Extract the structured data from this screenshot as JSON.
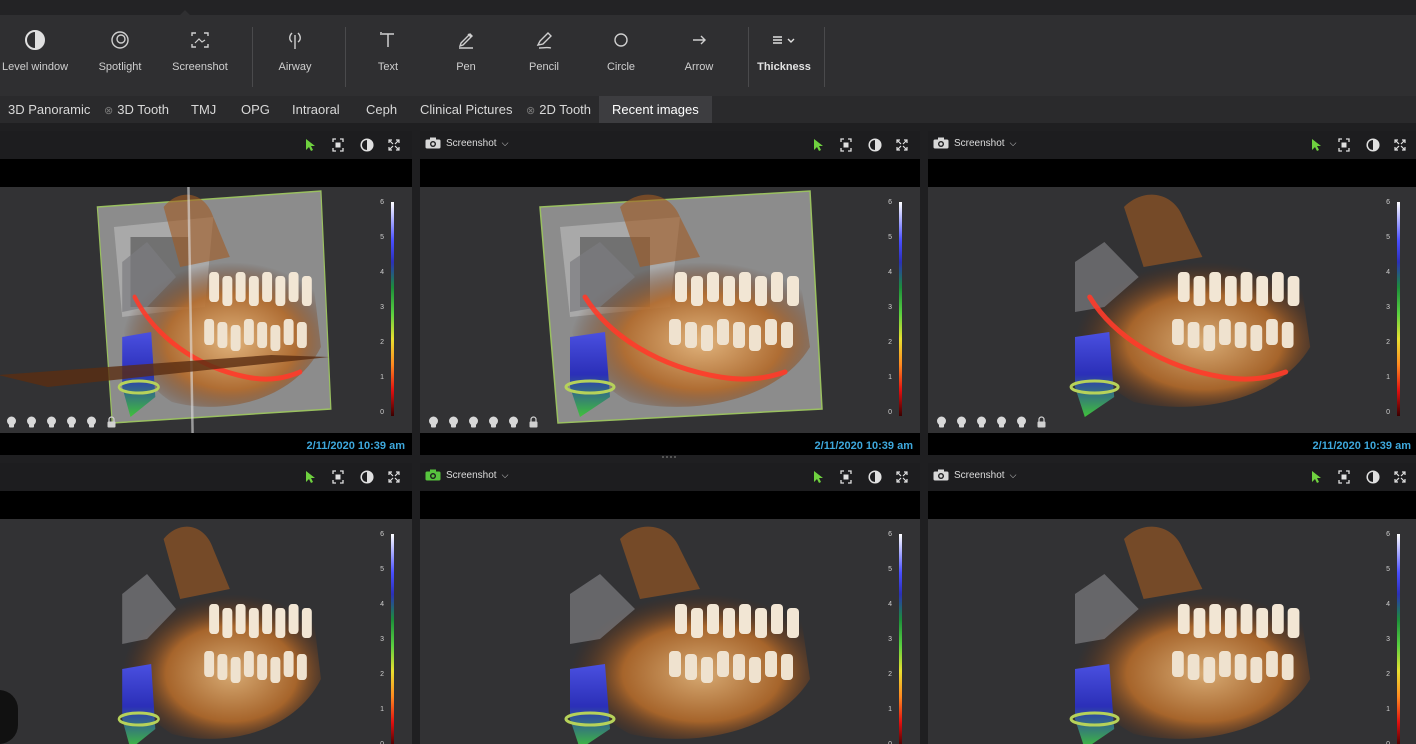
{
  "toolbar": {
    "tools": [
      {
        "label": "Level window",
        "icon": "level-window-icon"
      },
      {
        "label": "Spotlight",
        "icon": "spotlight-icon"
      },
      {
        "label": "Screenshot",
        "icon": "screenshot-icon"
      },
      {
        "label": "Airway",
        "icon": "airway-icon"
      },
      {
        "label": "Text",
        "icon": "text-icon"
      },
      {
        "label": "Pen",
        "icon": "pen-icon"
      },
      {
        "label": "Pencil",
        "icon": "pencil-icon"
      },
      {
        "label": "Circle",
        "icon": "circle-icon"
      },
      {
        "label": "Arrow",
        "icon": "arrow-icon"
      },
      {
        "label": "Thickness",
        "icon": "thickness-icon"
      }
    ]
  },
  "tabs": [
    {
      "label": "3D Panoramic",
      "disabled_icon": false
    },
    {
      "label": "3D Tooth",
      "disabled_icon": true
    },
    {
      "label": "TMJ",
      "disabled_icon": false
    },
    {
      "label": "OPG",
      "disabled_icon": false
    },
    {
      "label": "Intraoral",
      "disabled_icon": false
    },
    {
      "label": "Ceph",
      "disabled_icon": false
    },
    {
      "label": "Clinical Pictures",
      "disabled_icon": false
    },
    {
      "label": "2D Tooth",
      "disabled_icon": true
    },
    {
      "label": "Recent images",
      "active": true
    }
  ],
  "panels": [
    {
      "screenshot_label": "",
      "timestamp": "2/11/2020 10:39 am",
      "camera_active": false
    },
    {
      "screenshot_label": "Screenshot",
      "timestamp": "2/11/2020 10:39 am",
      "camera_active": false
    },
    {
      "screenshot_label": "Screenshot",
      "timestamp": "2/11/2020 10:39 am",
      "camera_active": false
    },
    {
      "screenshot_label": "",
      "timestamp": "",
      "camera_active": false
    },
    {
      "screenshot_label": "Screenshot",
      "timestamp": "",
      "camera_active": true
    },
    {
      "screenshot_label": "Screenshot",
      "timestamp": "",
      "camera_active": false
    }
  ],
  "colorbar": {
    "ticks": [
      "6",
      "5",
      "4",
      "3",
      "2",
      "1",
      "0"
    ]
  },
  "colors": {
    "accent_blue": "#3ea8dc",
    "cursor_green": "#6fd13f",
    "camera_active_green": "#57c43e"
  }
}
